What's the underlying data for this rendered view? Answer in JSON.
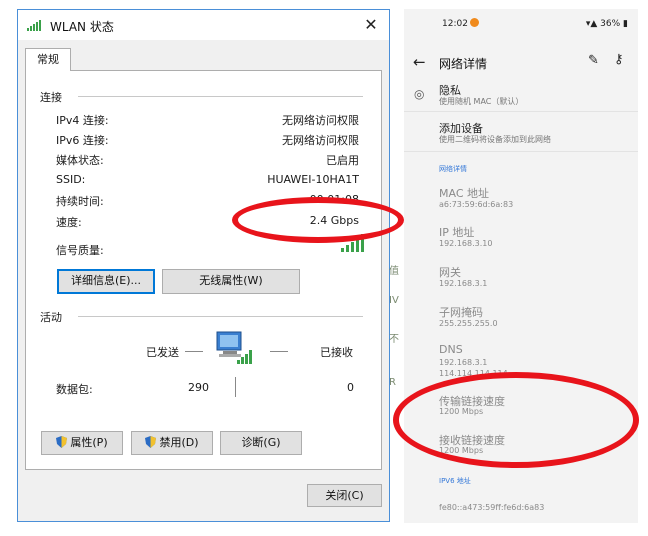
{
  "dialog": {
    "title": "WLAN 状态",
    "tab": "常规",
    "connection": {
      "heading": "连接",
      "rows": [
        {
          "label": "IPv4 连接:",
          "value": "无网络访问权限"
        },
        {
          "label": "IPv6 连接:",
          "value": "无网络访问权限"
        },
        {
          "label": "媒体状态:",
          "value": "已启用"
        },
        {
          "label": "SSID:",
          "value": "HUAWEI-10HA1T"
        },
        {
          "label": "持续时间:",
          "value": "00:01:08"
        },
        {
          "label": "速度:",
          "value": "2.4 Gbps"
        }
      ],
      "signal_label": "信号质量:",
      "signal_bars": 5,
      "details_button": "详细信息(E)...",
      "wireless_button": "无线属性(W)"
    },
    "activity": {
      "heading": "活动",
      "sent_label": "已发送",
      "received_label": "已接收",
      "packets_label": "数据包:",
      "sent_value": "290",
      "received_value": "0"
    },
    "buttons": {
      "properties": "属性(P)",
      "disable": "禁用(D)",
      "diagnose": "诊断(G)",
      "close": "关闭(C)"
    },
    "colors": {
      "accent": "#0078d7",
      "signal": "#3aa14a",
      "highlight": "#e8141b"
    }
  },
  "phone": {
    "status_bar": {
      "time": "12:02",
      "battery": "36%"
    },
    "header": {
      "title": "网络详情"
    },
    "privacy": {
      "title": "隐私",
      "subtitle": "使用随机 MAC（默认）"
    },
    "add_device": {
      "title": "添加设备",
      "subtitle": "使用二维码将设备添加到此网络"
    },
    "section_title": "网络详情",
    "details": [
      {
        "label": "MAC 地址",
        "value": "a6:73:59:6d:6a:83"
      },
      {
        "label": "IP 地址",
        "value": "192.168.3.10"
      },
      {
        "label": "网关",
        "value": "192.168.3.1"
      },
      {
        "label": "子网掩码",
        "value": "255.255.255.0"
      },
      {
        "label": "DNS",
        "value": "192.168.3.1\n114.114.114.114"
      },
      {
        "label": "传输链接速度",
        "value": "1200 Mbps"
      },
      {
        "label": "接收链接速度",
        "value": "1200 Mbps"
      }
    ],
    "ipv6": {
      "section": "IPV6 地址",
      "value": "fe80::a473:59ff:fe6d:6a83"
    }
  },
  "background_glyphs": [
    "值",
    "IV",
    "不",
    "R"
  ]
}
